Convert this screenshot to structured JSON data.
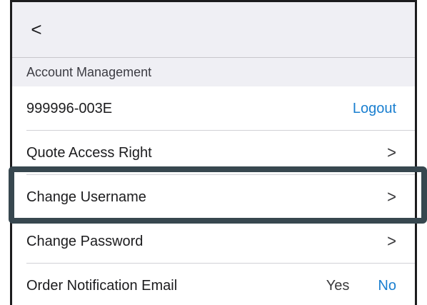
{
  "nav": {
    "back_icon": "chevron-left-icon",
    "back_glyph": "<"
  },
  "section": {
    "title": "Account Management"
  },
  "account": {
    "id": "999996-003E",
    "logout_label": "Logout"
  },
  "rows": {
    "quote_access": {
      "label": "Quote Access Right",
      "chevron": ">"
    },
    "change_username": {
      "label": "Change Username",
      "chevron": ">"
    },
    "change_password": {
      "label": "Change Password",
      "chevron": ">"
    },
    "order_email": {
      "label": "Order Notification Email",
      "yes": "Yes",
      "no": "No"
    }
  },
  "colors": {
    "accent": "#1a7fd0",
    "highlight_border": "#37474f",
    "header_bg": "#efeff4"
  }
}
